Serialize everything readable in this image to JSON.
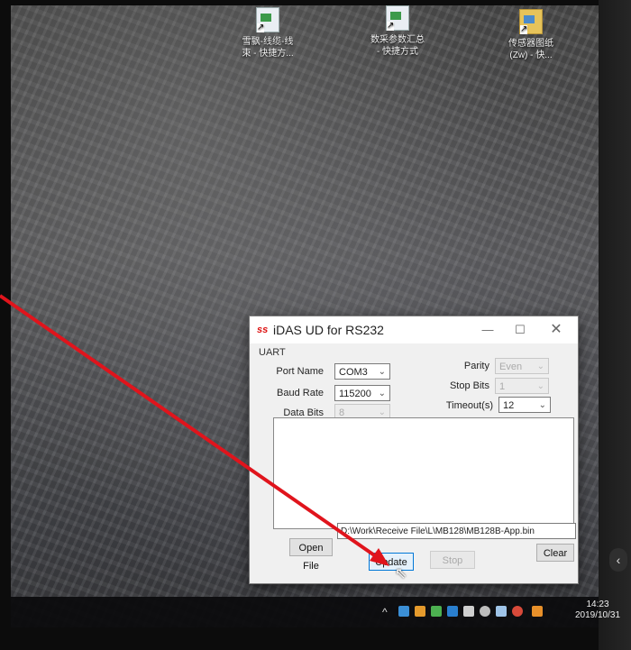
{
  "desktop": {
    "icons": [
      {
        "label": "雪飘-线缆-线\n束 - 快捷方...",
        "icon": "shortcut-file-icon"
      },
      {
        "label": "数采参数汇总\n- 快捷方式",
        "icon": "shortcut-file-icon"
      },
      {
        "label": "传感器图纸\n(Zw) - 快...",
        "icon": "shortcut-folder-icon"
      }
    ]
  },
  "window": {
    "logo": "ss",
    "title": "iDAS UD for RS232",
    "controls": {
      "minimize": "—",
      "maximize": "☐",
      "close": "✕"
    },
    "group_label": "UART",
    "fields": {
      "port_name": {
        "label": "Port Name",
        "value": "COM3"
      },
      "baud_rate": {
        "label": "Baud Rate",
        "value": "115200"
      },
      "data_bits": {
        "label": "Data Bits",
        "value": "8"
      },
      "parity": {
        "label": "Parity",
        "value": "Even"
      },
      "stop_bits": {
        "label": "Stop Bits",
        "value": "1"
      },
      "timeout": {
        "label": "Timeout(s)",
        "value": "12"
      }
    },
    "file_path": "D:\\Work\\Receive File\\L\\MB128\\MB128B-App.bin",
    "buttons": {
      "open_file": "Open File",
      "update": "Update",
      "stop": "Stop",
      "clear": "Clear"
    }
  },
  "taskbar": {
    "time": "14:23",
    "date": "2019/10/31",
    "tray_chevron": "^"
  },
  "annotation_color": "#e0141c"
}
